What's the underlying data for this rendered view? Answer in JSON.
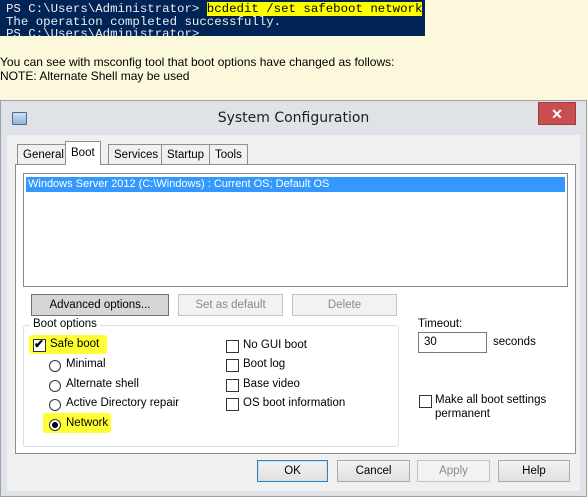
{
  "powershell": {
    "prompt": "PS C:\\Users\\Administrator> ",
    "command": "bcdedit /set safeboot network",
    "output": "The operation completed successfully.",
    "prompt2": "PS C:\\Users\\Administrator>"
  },
  "notes": {
    "line1": "You can see with msconfig tool that boot options have changed as follows:",
    "line2": "NOTE: Alternate Shell may be used"
  },
  "window": {
    "title": "System Configuration",
    "close_label": "✕"
  },
  "tabs": [
    {
      "label": "General"
    },
    {
      "label": "Boot"
    },
    {
      "label": "Services"
    },
    {
      "label": "Startup"
    },
    {
      "label": "Tools"
    }
  ],
  "os_list": {
    "selected_entry": "Windows Server 2012 (C:\\Windows) : Current OS; Default OS"
  },
  "buttons": {
    "advanced": "Advanced options...",
    "set_default": "Set as default",
    "delete": "Delete",
    "ok": "OK",
    "cancel": "Cancel",
    "apply": "Apply",
    "help": "Help"
  },
  "boot_options": {
    "group_label": "Boot options",
    "safe_boot": {
      "label": "Safe boot",
      "checked": true
    },
    "radios": [
      {
        "label": "Minimal",
        "checked": false
      },
      {
        "label": "Alternate shell",
        "checked": false
      },
      {
        "label": "Active Directory repair",
        "checked": false
      },
      {
        "label": "Network",
        "checked": true
      }
    ],
    "checks": [
      {
        "label": "No GUI boot",
        "checked": false
      },
      {
        "label": "Boot log",
        "checked": false
      },
      {
        "label": "Base video",
        "checked": false
      },
      {
        "label": "OS boot information",
        "checked": false
      }
    ]
  },
  "timeout": {
    "label": "Timeout:",
    "value": "30",
    "unit": "seconds"
  },
  "make_permanent": {
    "label_line1": "Make all boot settings",
    "label_line2": "permanent",
    "checked": false
  },
  "colors": {
    "highlight": "#ffff33",
    "selection": "#3399ff",
    "powershell_bg": "#012456",
    "close_button": "#c74f4f"
  }
}
